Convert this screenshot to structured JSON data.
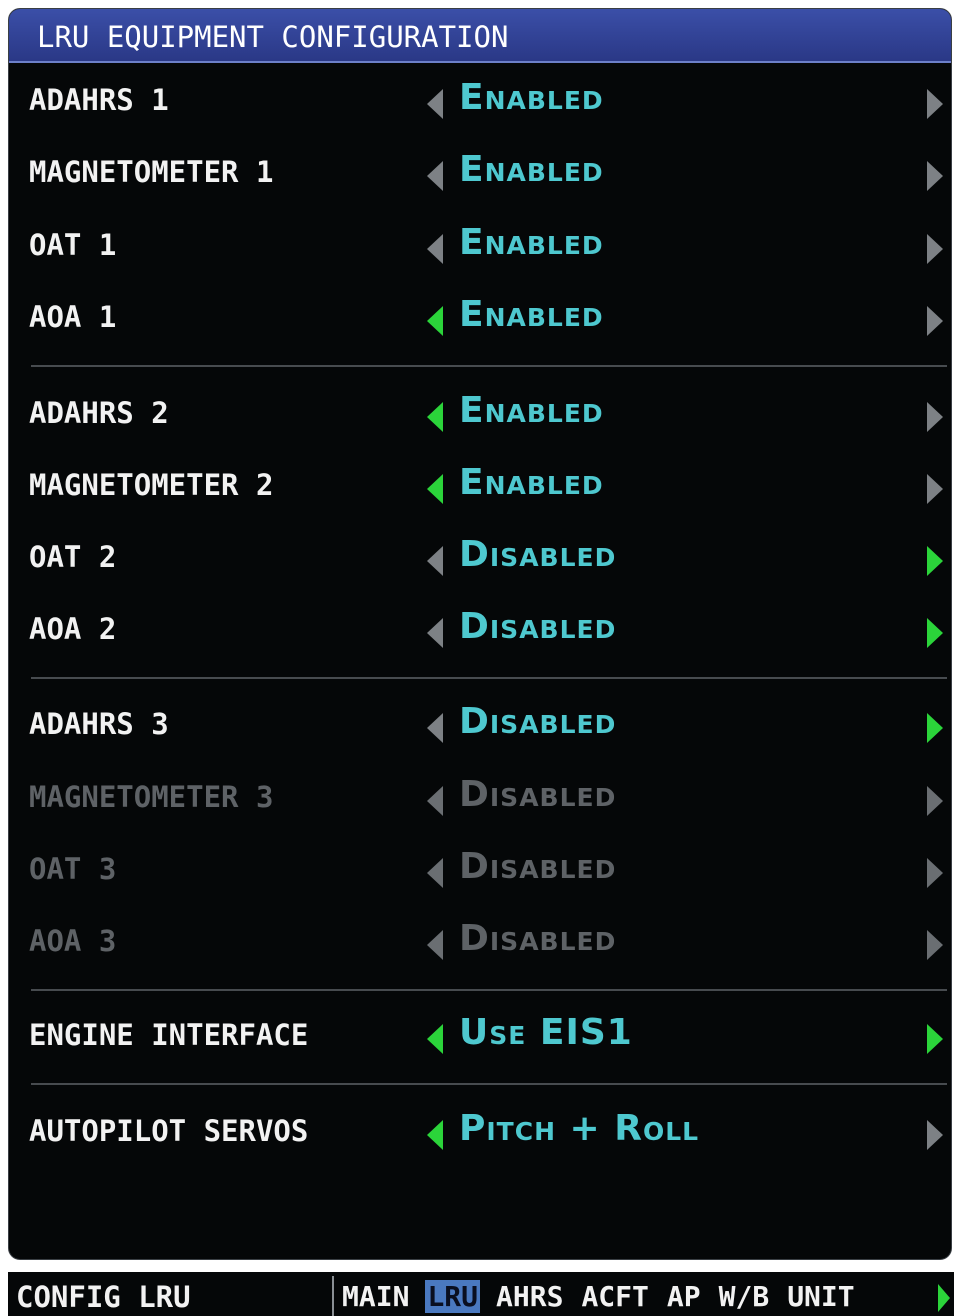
{
  "window": {
    "title": "LRU EQUIPMENT CONFIGURATION"
  },
  "colors": {
    "value_text": "#4ec8cf",
    "active_arrow": "#2bd43a",
    "inactive_arrow": "#7d8185",
    "title_bar": "#2f3f95"
  },
  "rows": [
    {
      "label": "ADAHRS 1",
      "value": "Enabled",
      "left_active": false,
      "right_active": false,
      "dim": false
    },
    {
      "label": "MAGNETOMETER 1",
      "value": "Enabled",
      "left_active": false,
      "right_active": false,
      "dim": false
    },
    {
      "label": "OAT 1",
      "value": "Enabled",
      "left_active": false,
      "right_active": false,
      "dim": false
    },
    {
      "label": "AOA 1",
      "value": "Enabled",
      "left_active": true,
      "right_active": false,
      "dim": false
    },
    {
      "label": "ADAHRS 2",
      "value": "Enabled",
      "left_active": true,
      "right_active": false,
      "dim": false
    },
    {
      "label": "MAGNETOMETER 2",
      "value": "Enabled",
      "left_active": true,
      "right_active": false,
      "dim": false
    },
    {
      "label": "OAT 2",
      "value": "Disabled",
      "left_active": false,
      "right_active": true,
      "dim": false
    },
    {
      "label": "AOA 2",
      "value": "Disabled",
      "left_active": false,
      "right_active": true,
      "dim": false
    },
    {
      "label": "ADAHRS 3",
      "value": "Disabled",
      "left_active": false,
      "right_active": true,
      "dim": false
    },
    {
      "label": "MAGNETOMETER 3",
      "value": "Disabled",
      "left_active": false,
      "right_active": false,
      "dim": true
    },
    {
      "label": "OAT 3",
      "value": "Disabled",
      "left_active": false,
      "right_active": false,
      "dim": true
    },
    {
      "label": "AOA 3",
      "value": "Disabled",
      "left_active": false,
      "right_active": false,
      "dim": true
    },
    {
      "label": "ENGINE INTERFACE",
      "value": "Use EIS1",
      "left_active": true,
      "right_active": true,
      "dim": false
    },
    {
      "label": "AUTOPILOT SERVOS",
      "value": "Pitch + Roll",
      "left_active": true,
      "right_active": false,
      "dim": false
    }
  ],
  "footer": {
    "page_name": "CONFIG LRU",
    "tabs": [
      "MAIN",
      "LRU",
      "AHRS",
      "ACFT",
      "AP",
      "W/B",
      "UNIT"
    ],
    "active_tab": "LRU"
  }
}
